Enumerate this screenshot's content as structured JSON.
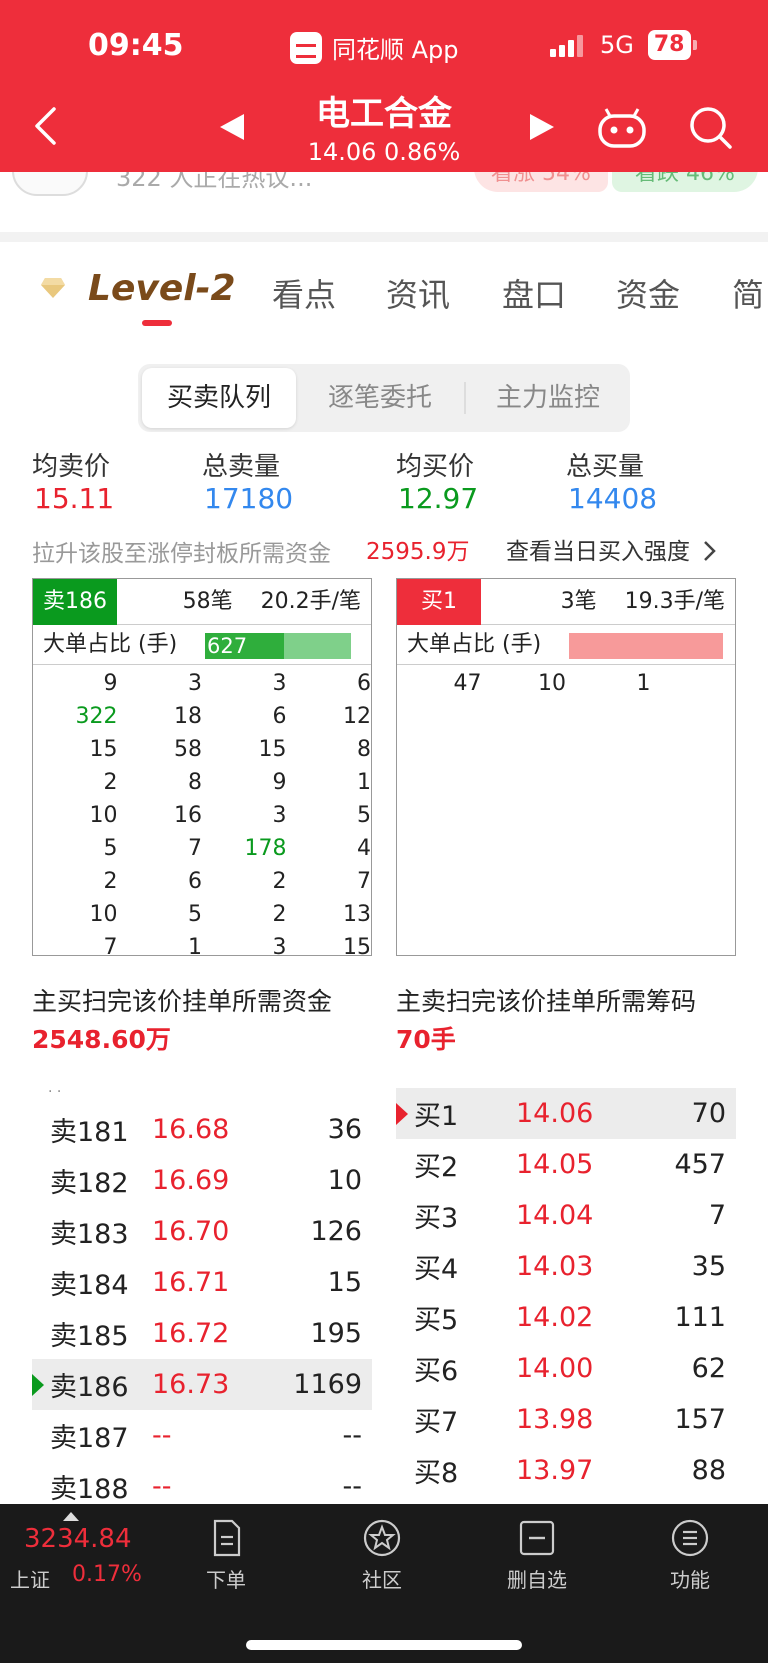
{
  "status": {
    "time": "09:45",
    "app_name": "同花顺 App",
    "network": "5G",
    "battery": "78"
  },
  "nav": {
    "stock_name": "电工合金",
    "price_line": "14.06 0.86%"
  },
  "peek": {
    "text": "322 人正在热议...",
    "up": "看涨 54%",
    "down": "看跌 46%"
  },
  "tabs": {
    "level2": "Level-2",
    "items": [
      "看点",
      "资讯",
      "盘口",
      "资金",
      "简"
    ]
  },
  "segment": [
    "买卖队列",
    "逐笔委托",
    "主力监控"
  ],
  "summary": {
    "avg_sell_label": "均卖价",
    "avg_sell": "15.11",
    "total_sell_label": "总卖量",
    "total_sell": "17180",
    "avg_buy_label": "均买价",
    "avg_buy": "12.97",
    "total_buy_label": "总买量",
    "total_buy": "14408",
    "limit_label": "拉升该股至涨停封板所需资金",
    "limit_value": "2595.9万",
    "strength_link": "查看当日买入强度"
  },
  "sell_queue": {
    "badge": "卖186",
    "orders": "58笔",
    "avg": "20.2手/笔",
    "big_label": "大单占比 (手)",
    "big_value": "627",
    "rows": [
      [
        "9",
        "3",
        "3",
        "6"
      ],
      [
        "322",
        "18",
        "6",
        "12"
      ],
      [
        "15",
        "58",
        "15",
        "8"
      ],
      [
        "2",
        "8",
        "9",
        "1"
      ],
      [
        "10",
        "16",
        "3",
        "5"
      ],
      [
        "5",
        "7",
        "178",
        "4"
      ],
      [
        "2",
        "6",
        "2",
        "7"
      ],
      [
        "10",
        "5",
        "2",
        "13"
      ],
      [
        "7",
        "1",
        "3",
        "15"
      ]
    ],
    "colors": {
      "badge": "#0a9a1e",
      "big_bar": "#2fae3c"
    }
  },
  "buy_queue": {
    "badge": "买1",
    "orders": "3笔",
    "avg": "19.3手/笔",
    "big_label": "大单占比 (手)",
    "rows": [
      [
        "47",
        "10",
        "1",
        ""
      ]
    ],
    "colors": {
      "badge": "#ee2e3b",
      "big_bar": "#f79a9a"
    }
  },
  "need": {
    "buy_label": "主买扫完该价挂单所需资金",
    "buy_value": "2548.60万",
    "sell_label": "主卖扫完该价挂单所需筹码",
    "sell_value": "70手"
  },
  "sell_book": [
    {
      "name": "卖181",
      "price": "16.68",
      "vol": "36"
    },
    {
      "name": "卖182",
      "price": "16.69",
      "vol": "10"
    },
    {
      "name": "卖183",
      "price": "16.70",
      "vol": "126"
    },
    {
      "name": "卖184",
      "price": "16.71",
      "vol": "15"
    },
    {
      "name": "卖185",
      "price": "16.72",
      "vol": "195"
    },
    {
      "name": "卖186",
      "price": "16.73",
      "vol": "1169"
    },
    {
      "name": "卖187",
      "price": "--",
      "vol": "--"
    },
    {
      "name": "卖188",
      "price": "--",
      "vol": "--"
    }
  ],
  "buy_book": [
    {
      "name": "买1",
      "price": "14.06",
      "vol": "70"
    },
    {
      "name": "买2",
      "price": "14.05",
      "vol": "457"
    },
    {
      "name": "买3",
      "price": "14.04",
      "vol": "7"
    },
    {
      "name": "买4",
      "price": "14.03",
      "vol": "35"
    },
    {
      "name": "买5",
      "price": "14.02",
      "vol": "111"
    },
    {
      "name": "买6",
      "price": "14.00",
      "vol": "62"
    },
    {
      "name": "买7",
      "price": "13.98",
      "vol": "157"
    },
    {
      "name": "买8",
      "price": "13.97",
      "vol": "88"
    }
  ],
  "bottom": {
    "index_value": "3234.84",
    "index_name": "上证",
    "index_pct": "0.17%",
    "items": [
      {
        "label": "下单",
        "icon": "order-icon"
      },
      {
        "label": "社区",
        "icon": "community-icon"
      },
      {
        "label": "删自选",
        "icon": "remove-watchlist-icon"
      },
      {
        "label": "功能",
        "icon": "menu-icon"
      }
    ]
  }
}
